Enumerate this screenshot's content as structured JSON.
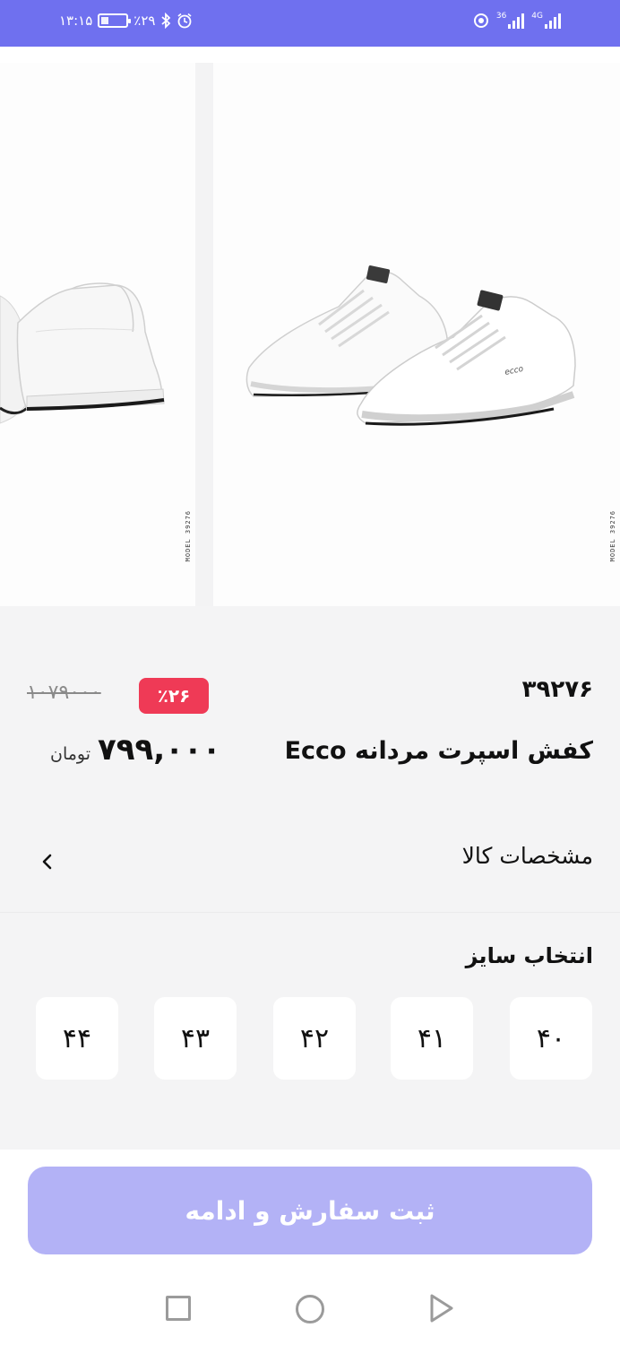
{
  "status_bar": {
    "time": "۱۳:۱۵",
    "battery": "٪۲۹",
    "network_1": "36",
    "network_2": "4G",
    "icons": [
      "battery-icon",
      "bluetooth-icon",
      "alarm-icon",
      "data-saver-icon",
      "signal-icon"
    ],
    "battery_level": 0.29
  },
  "gallery": {
    "prev_model_label": "MODEL 39276",
    "main_model_label": "MODEL 39276",
    "brand_on_shoe": "ecco"
  },
  "product": {
    "code": "۳۹۲۷۶",
    "title": "کفش اسپرت مردانه Ecco",
    "old_price": "۱۰۷۹۰۰۰",
    "discount": "٪۲۶",
    "price": "۷۹۹,۰۰۰",
    "currency": "تومان"
  },
  "specs": {
    "label": "مشخصات کالا",
    "icon": "chevron-left-icon"
  },
  "sizes": {
    "title": "انتخاب سایز",
    "options": [
      "۴۰",
      "۴۱",
      "۴۲",
      "۴۳",
      "۴۴"
    ]
  },
  "actions": {
    "submit_label": "ثبت سفارش و ادامه"
  },
  "nav": {
    "icons": [
      "recent-apps-icon",
      "home-icon",
      "back-icon"
    ]
  },
  "colors": {
    "primary": "#6f70ef",
    "button_disabled": "#b3b2f6",
    "discount": "#ef3a56",
    "background": "#f4f4f5"
  }
}
